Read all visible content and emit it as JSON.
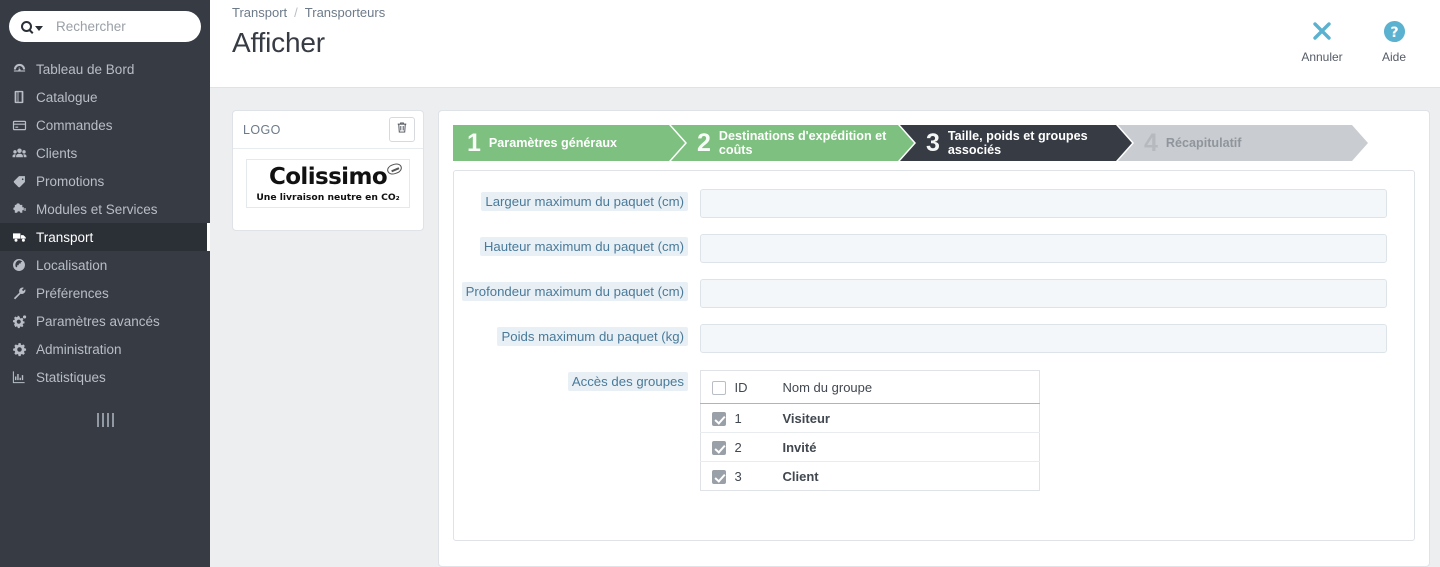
{
  "sidebar": {
    "search": {
      "placeholder": "Rechercher",
      "value": "",
      "icon": "search-icon",
      "caret": "caret-down-icon"
    },
    "items": [
      {
        "label": "Tableau de Bord",
        "icon": "dashboard-icon",
        "active": false
      },
      {
        "label": "Catalogue",
        "icon": "book-icon",
        "active": false
      },
      {
        "label": "Commandes",
        "icon": "card-icon",
        "active": false
      },
      {
        "label": "Clients",
        "icon": "users-icon",
        "active": false
      },
      {
        "label": "Promotions",
        "icon": "tag-icon",
        "active": false
      },
      {
        "label": "Modules et Services",
        "icon": "puzzle-icon",
        "active": false
      },
      {
        "label": "Transport",
        "icon": "truck-icon",
        "active": true
      },
      {
        "label": "Localisation",
        "icon": "globe-icon",
        "active": false
      },
      {
        "label": "Préférences",
        "icon": "wrench-icon",
        "active": false
      },
      {
        "label": "Paramètres avancés",
        "icon": "gears-icon",
        "active": false
      },
      {
        "label": "Administration",
        "icon": "gear-icon",
        "active": false
      },
      {
        "label": "Statistiques",
        "icon": "chart-bar-icon",
        "active": false
      }
    ]
  },
  "header": {
    "breadcrumb": {
      "parent": "Transport",
      "separator": "/",
      "current": "Transporteurs"
    },
    "title": "Afficher",
    "actions": [
      {
        "label": "Annuler",
        "icon": "close-x-icon",
        "color": "#5bb1d0"
      },
      {
        "label": "Aide",
        "icon": "help-circle-icon",
        "color": "#5bb1d0"
      }
    ]
  },
  "logo_card": {
    "caption": "LOGO",
    "delete_icon": "trash-icon",
    "image": {
      "brand": "Colissimo",
      "tagline": "Une livraison neutre en CO₂",
      "mark": "swoosh-icon"
    }
  },
  "wizard": {
    "steps": [
      {
        "num": "1",
        "label": "Paramètres généraux",
        "state": "done"
      },
      {
        "num": "2",
        "label": "Destinations d'expédition et coûts",
        "state": "done"
      },
      {
        "num": "3",
        "label": "Taille, poids et groupes associés",
        "state": "active"
      },
      {
        "num": "4",
        "label": "Récapitulatif",
        "state": "upcoming"
      }
    ],
    "colors": {
      "done": "#7dc07f",
      "active": "#363b44",
      "upcoming": "#c9ccd0"
    }
  },
  "form": {
    "fields": [
      {
        "label": "Largeur maximum du paquet (cm)",
        "value": "",
        "placeholder": ""
      },
      {
        "label": "Hauteur maximum du paquet (cm)",
        "value": "",
        "placeholder": ""
      },
      {
        "label": "Profondeur maximum du paquet (cm)",
        "value": "",
        "placeholder": ""
      },
      {
        "label": "Poids maximum du paquet (kg)",
        "value": "",
        "placeholder": ""
      }
    ],
    "groups": {
      "label": "Accès des groupes",
      "columns": {
        "select_all": "",
        "id": "ID",
        "name": "Nom du groupe"
      },
      "select_all_checked": false,
      "rows": [
        {
          "checked": true,
          "id": "1",
          "name": "Visiteur"
        },
        {
          "checked": true,
          "id": "2",
          "name": "Invité"
        },
        {
          "checked": true,
          "id": "3",
          "name": "Client"
        }
      ]
    }
  }
}
